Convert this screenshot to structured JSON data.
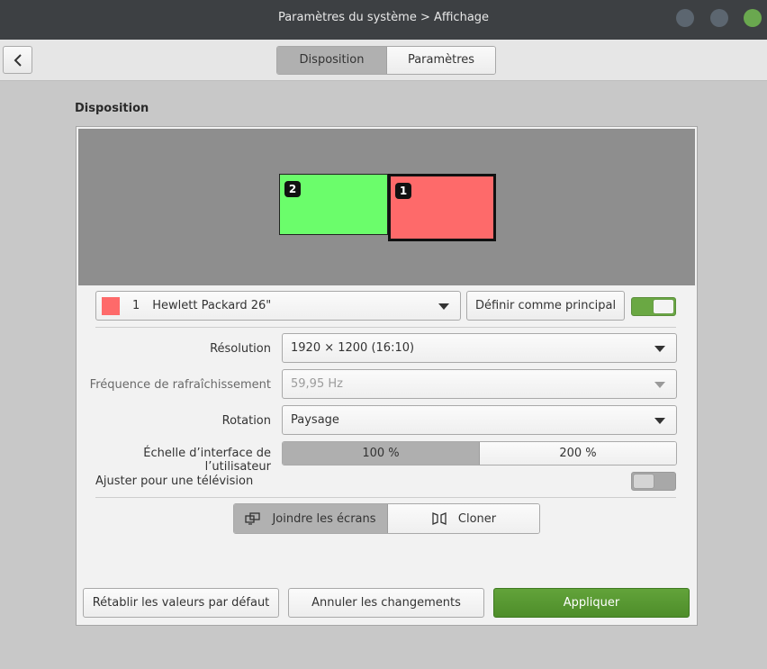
{
  "window": {
    "title": "Paramètres du système > Affichage"
  },
  "toolbar": {
    "tabs": [
      {
        "label": "Disposition",
        "active": true
      },
      {
        "label": "Paramètres",
        "active": false
      }
    ]
  },
  "section": {
    "label": "Disposition"
  },
  "arrangement": {
    "monitors": [
      {
        "number": "2",
        "color": "#6bfd6b",
        "selected": false
      },
      {
        "number": "1",
        "color": "#fe6a6a",
        "selected": true
      }
    ]
  },
  "display_select": {
    "number": "1",
    "name": "Hewlett Packard 26\"",
    "swatch_color": "#fe6a6a"
  },
  "primary_button": {
    "label": "Définir comme principal"
  },
  "display_enabled": true,
  "settings": {
    "resolution": {
      "label": "Résolution",
      "value": "1920 × 1200 (16:10)"
    },
    "refresh": {
      "label": "Fréquence de rafraîchissement",
      "value": "59,95 Hz",
      "disabled": true
    },
    "rotation": {
      "label": "Rotation",
      "value": "Paysage"
    },
    "scale": {
      "label": "Échelle d’interface de l’utilisateur",
      "options": [
        "100 %",
        "200 %"
      ],
      "selected": "100 %"
    },
    "tv": {
      "label": "Ajuster pour une télévision",
      "enabled": false
    }
  },
  "mode": {
    "join_label": "Joindre les écrans",
    "clone_label": "Cloner",
    "selected": "join"
  },
  "footer": {
    "reset_label": "Rétablir les valeurs par défaut",
    "cancel_label": "Annuler les changements",
    "apply_label": "Appliquer"
  },
  "colors": {
    "accent": "#5a9a33",
    "titlebar": "#3d4043",
    "close_button": "#6aa84f"
  },
  "icons": {
    "back": "chevron-left-icon",
    "join": "join-displays-icon",
    "clone": "clone-displays-icon"
  }
}
